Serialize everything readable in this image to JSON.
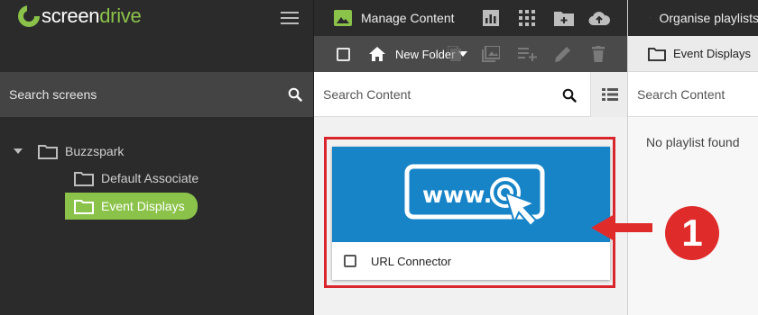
{
  "brand": {
    "screen": "screen",
    "drive": "drive"
  },
  "sidebar": {
    "search_label": "Search screens",
    "tree": [
      {
        "label": "Buzzspark"
      },
      {
        "label": "Default Associate"
      },
      {
        "label": "Event Displays",
        "selected": true
      }
    ]
  },
  "content_panel": {
    "title": "Manage Content",
    "toolbar": {
      "new_folder_label": "New Folder"
    },
    "search_label": "Search Content",
    "items": [
      {
        "name": "URL Connector",
        "thumb_text": "www."
      }
    ]
  },
  "playlist_panel": {
    "title": "Organise playlists",
    "folder": "Event Displays",
    "search_label": "Search Content",
    "empty_message": "No playlist found"
  },
  "annotation": {
    "step": "1"
  },
  "colors": {
    "accent_green": "#8bc34a",
    "highlight_red": "#d9262c",
    "thumb_blue": "#1784c7"
  }
}
